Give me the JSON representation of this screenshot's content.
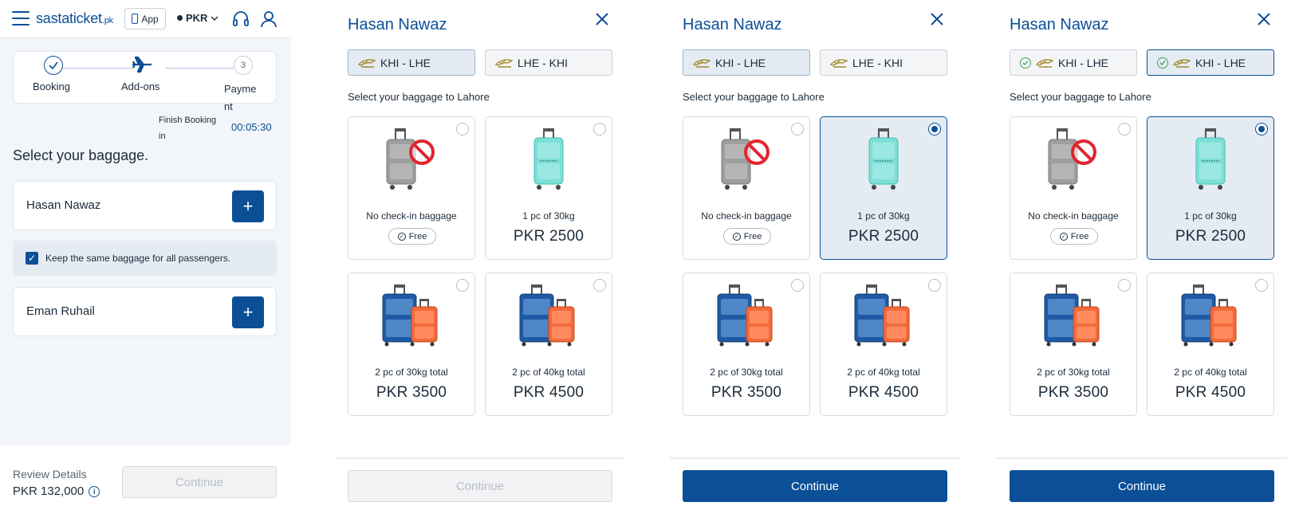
{
  "header": {
    "logo": "sastaticket",
    "logo_suffix": ".pk",
    "app_label": "App",
    "currency": "PKR"
  },
  "steps": [
    {
      "label": "Booking",
      "state": "done"
    },
    {
      "label": "Add-ons",
      "state": "current"
    },
    {
      "label": "Payment",
      "state": "upcoming",
      "number": "3"
    }
  ],
  "finish_booking_label": "Finish Booking in",
  "timer": "00:05:30",
  "select_title": "Select your baggage.",
  "passengers": [
    {
      "name": "Hasan Nawaz"
    },
    {
      "name": "Eman Ruhail"
    }
  ],
  "keep_same": {
    "label": "Keep the same baggage for all passengers.",
    "checked": true
  },
  "footer": {
    "review_label": "Review Details",
    "total": "PKR 132,000",
    "continue": "Continue"
  },
  "modal": {
    "passenger_name": "Hasan Nawaz",
    "subtitle": "Select your baggage to Lahore",
    "continue": "Continue",
    "options": [
      {
        "label": "No check-in baggage",
        "price": "Free"
      },
      {
        "label": "1 pc of 30kg",
        "price": "PKR 2500"
      },
      {
        "label": "2 pc of 30kg total",
        "price": "PKR 3500"
      },
      {
        "label": "2 pc of 40kg total",
        "price": "PKR 4500"
      }
    ]
  },
  "panels": [
    {
      "tabs": [
        "KHI - LHE",
        "LHE - KHI"
      ],
      "active_tab": 0,
      "selected_option": null,
      "continue_enabled": false
    },
    {
      "tabs": [
        "KHI - LHE",
        "LHE - KHI"
      ],
      "active_tab": 0,
      "selected_option": 1,
      "continue_enabled": true
    },
    {
      "tabs": [
        "KHI - LHE",
        "KHI - LHE"
      ],
      "active_tab": 1,
      "selected_option": 1,
      "continue_enabled": true,
      "tabs_checked": true
    }
  ],
  "colors": {
    "primary": "#0b4f97",
    "selected_bg": "#e4ebf3",
    "check_green": "#3aa856",
    "bag_orange": "#f26a3c",
    "bag_teal": "#7fdfd6"
  }
}
